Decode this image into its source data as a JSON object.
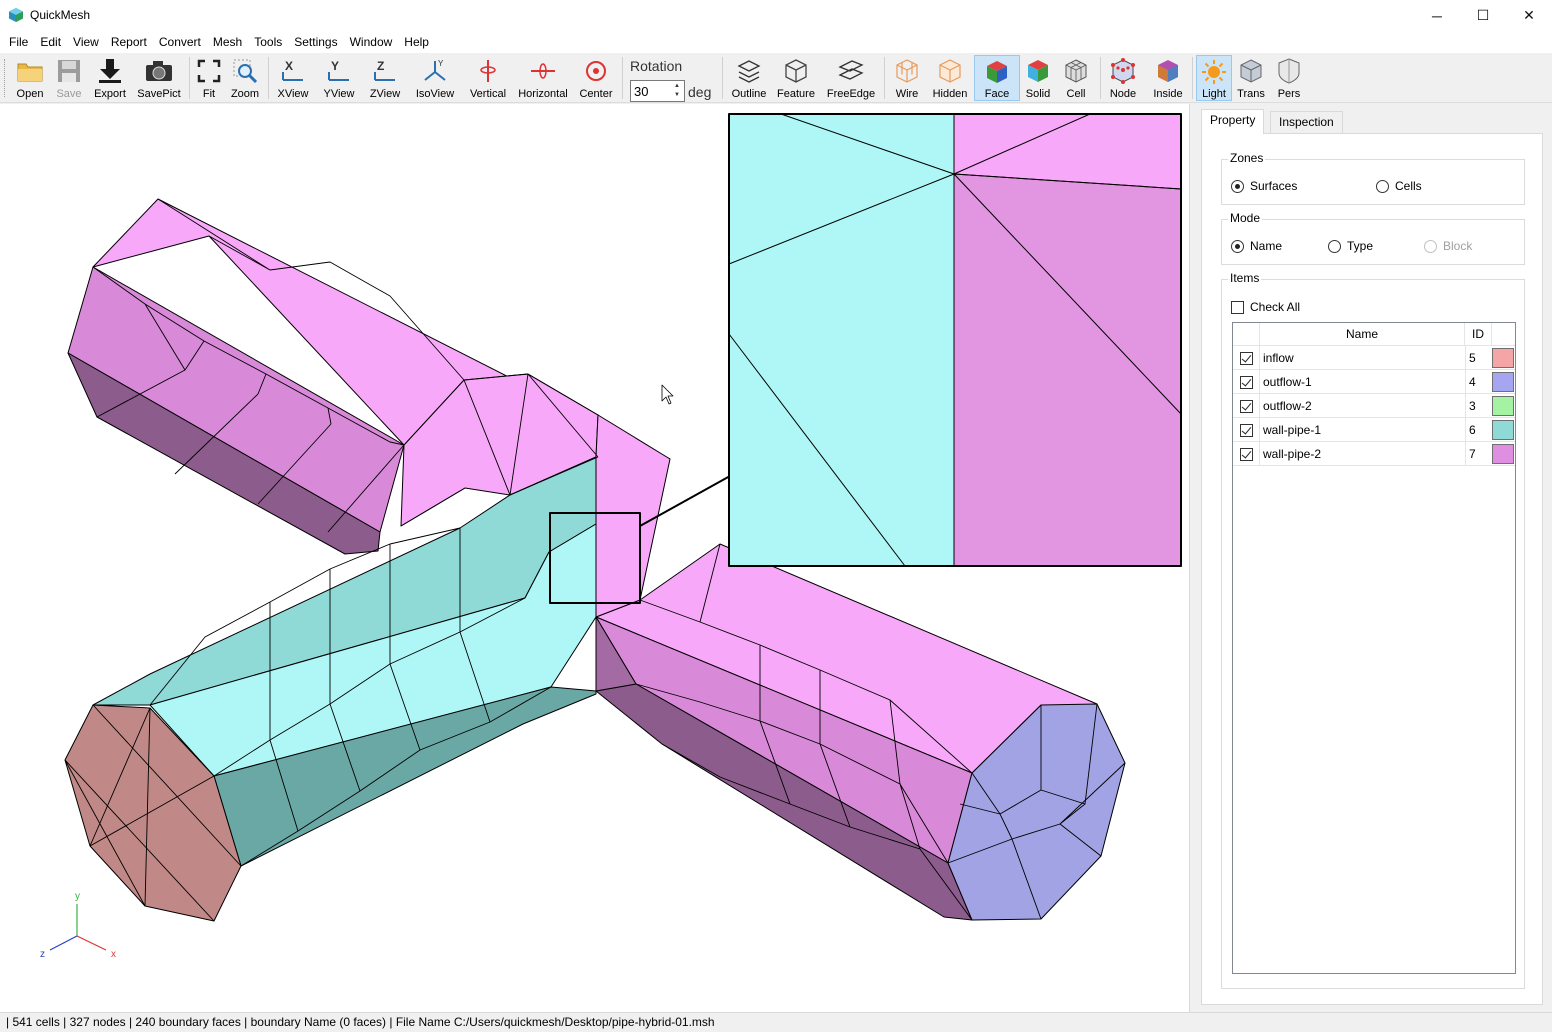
{
  "window": {
    "title": "QuickMesh",
    "minimize_glyph": "─",
    "maximize_glyph": "☐",
    "close_glyph": "✕"
  },
  "menu": [
    "File",
    "Edit",
    "View",
    "Report",
    "Convert",
    "Mesh",
    "Tools",
    "Settings",
    "Window",
    "Help"
  ],
  "toolbar": {
    "buttons": [
      {
        "label": "Open",
        "icon": "folder-icon"
      },
      {
        "label": "Save",
        "icon": "save-icon",
        "disabled": true
      },
      {
        "label": "Export",
        "icon": "export-icon"
      },
      {
        "label": "SavePict",
        "icon": "camera-icon"
      },
      {
        "label": "Fit",
        "icon": "fit-icon"
      },
      {
        "label": "Zoom",
        "icon": "zoom-icon"
      },
      {
        "label": "XView",
        "icon": "xview-icon"
      },
      {
        "label": "YView",
        "icon": "yview-icon"
      },
      {
        "label": "ZView",
        "icon": "zview-icon"
      },
      {
        "label": "IsoView",
        "icon": "isoview-icon"
      },
      {
        "label": "Vertical",
        "icon": "vertical-rotate-icon"
      },
      {
        "label": "Horizontal",
        "icon": "horizontal-rotate-icon"
      },
      {
        "label": "Center",
        "icon": "center-icon"
      },
      {
        "label": "Outline",
        "icon": "outline-icon"
      },
      {
        "label": "Feature",
        "icon": "feature-icon"
      },
      {
        "label": "FreeEdge",
        "icon": "freeedge-icon"
      },
      {
        "label": "Wire",
        "icon": "wire-icon"
      },
      {
        "label": "Hidden",
        "icon": "hidden-icon"
      },
      {
        "label": "Face",
        "icon": "face-icon",
        "active": true
      },
      {
        "label": "Solid",
        "icon": "solid-icon"
      },
      {
        "label": "Cell",
        "icon": "cell-icon"
      },
      {
        "label": "Node",
        "icon": "node-icon"
      },
      {
        "label": "Inside",
        "icon": "inside-icon"
      },
      {
        "label": "Light",
        "icon": "light-icon",
        "active": true
      },
      {
        "label": "Trans",
        "icon": "transparent-icon"
      },
      {
        "label": "Pers",
        "icon": "perspective-icon"
      }
    ],
    "rotation": {
      "label": "Rotation",
      "value": "30",
      "unit": "deg"
    }
  },
  "viewport": {
    "axes": {
      "x": "x",
      "y": "y",
      "z": "z"
    }
  },
  "panel": {
    "tabs": [
      "Property",
      "Inspection"
    ],
    "zones": {
      "title": "Zones",
      "options": [
        {
          "label": "Surfaces",
          "selected": true
        },
        {
          "label": "Cells",
          "selected": false
        }
      ]
    },
    "mode": {
      "title": "Mode",
      "options": [
        {
          "label": "Name",
          "selected": true
        },
        {
          "label": "Type",
          "selected": false
        },
        {
          "label": "Block",
          "selected": false,
          "disabled": true
        }
      ]
    },
    "items": {
      "title": "Items",
      "check_all": "Check All",
      "columns": [
        "Name",
        "ID"
      ],
      "rows": [
        {
          "name": "inflow",
          "id": "5",
          "color": "#f4a5a5",
          "checked": true
        },
        {
          "name": "outflow-1",
          "id": "4",
          "color": "#a5a5f2",
          "checked": true
        },
        {
          "name": "outflow-2",
          "id": "3",
          "color": "#a5f2a5",
          "checked": true
        },
        {
          "name": "wall-pipe-1",
          "id": "6",
          "color": "#8fd9d6",
          "checked": true
        },
        {
          "name": "wall-pipe-2",
          "id": "7",
          "color": "#df8fdf",
          "checked": true
        }
      ]
    }
  },
  "status": "| 541 cells | 327 nodes | 240 boundary faces |  boundary Name  (0 faces) | File Name C:/Users/quickmesh/Desktop/pipe-hybrid-01.msh"
}
